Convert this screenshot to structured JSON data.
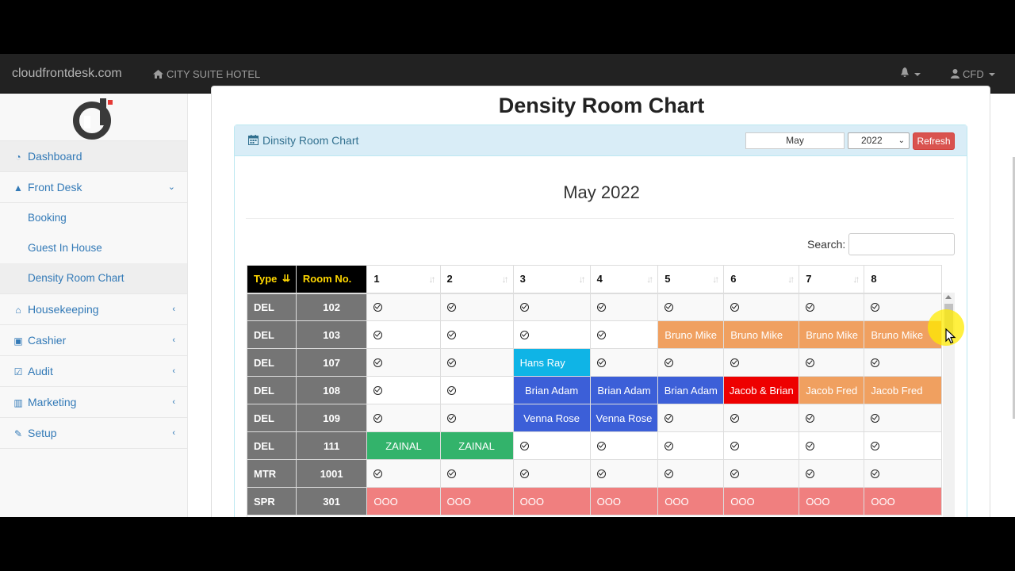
{
  "navbar": {
    "brand": "cloudfrontdesk.com",
    "hotel": "CITY SUITE HOTEL",
    "user": "CFD"
  },
  "sidebar": {
    "items": [
      {
        "label": "Dashboard",
        "icon": "dashboard-icon"
      },
      {
        "label": "Front Desk",
        "icon": "bell-icon",
        "expanded": true,
        "children": [
          {
            "label": "Booking"
          },
          {
            "label": "Guest In House"
          },
          {
            "label": "Density Room Chart",
            "active": true
          }
        ]
      },
      {
        "label": "Housekeeping",
        "icon": "home-icon"
      },
      {
        "label": "Cashier",
        "icon": "money-icon"
      },
      {
        "label": "Audit",
        "icon": "check-square-icon"
      },
      {
        "label": "Marketing",
        "icon": "bar-chart-icon"
      },
      {
        "label": "Setup",
        "icon": "wrench-icon"
      }
    ]
  },
  "main": {
    "page_title": "Density Room Chart",
    "panel_title": "Dinsity Room Chart",
    "month_value": "May",
    "year_value": "2022",
    "refresh_label": "Refresh",
    "calendar_title": "May 2022",
    "search_label": "Search:",
    "search_value": ""
  },
  "table": {
    "headers": [
      "Type",
      "Room No.",
      "1",
      "2",
      "3",
      "4",
      "5",
      "6",
      "7",
      "8"
    ],
    "rows": [
      {
        "type": "DEL",
        "room": "102",
        "cells": [
          "",
          "",
          "",
          "",
          "",
          "",
          "",
          ""
        ]
      },
      {
        "type": "DEL",
        "room": "103",
        "cells": [
          "",
          "",
          "",
          "",
          "Bruno Mike",
          "Bruno Mike",
          "Bruno Mike",
          "Bruno Mike"
        ]
      },
      {
        "type": "DEL",
        "room": "107",
        "cells": [
          "",
          "",
          "Hans Ray",
          "",
          "",
          "",
          "",
          ""
        ]
      },
      {
        "type": "DEL",
        "room": "108",
        "cells": [
          "",
          "",
          "Brian Adam",
          "Brian Adam",
          "Brian Adam",
          "Jacob & Brian",
          "Jacob Fred",
          "Jacob Fred"
        ]
      },
      {
        "type": "DEL",
        "room": "109",
        "cells": [
          "",
          "",
          "Venna Rose",
          "Venna Rose",
          "",
          "",
          "",
          ""
        ]
      },
      {
        "type": "DEL",
        "room": "111",
        "cells": [
          "ZAINAL",
          "ZAINAL",
          "",
          "",
          "",
          "",
          "",
          ""
        ]
      },
      {
        "type": "MTR",
        "room": "1001",
        "cells": [
          "",
          "",
          "",
          "",
          "",
          "",
          "",
          ""
        ]
      },
      {
        "type": "SPR",
        "room": "301",
        "cells": [
          "OOO",
          "OOO",
          "OOO",
          "OOO",
          "OOO",
          "OOO",
          "OOO",
          "OOO"
        ]
      }
    ],
    "colors": {
      "orange": "#f0a060",
      "cyan": "#0fb4e6",
      "blue": "#3c5fd8",
      "red": "#ee0000",
      "green": "#33b36b",
      "ooo": "#f07f7f",
      "header_dark": "#000000",
      "type_gray": "#757575"
    }
  }
}
